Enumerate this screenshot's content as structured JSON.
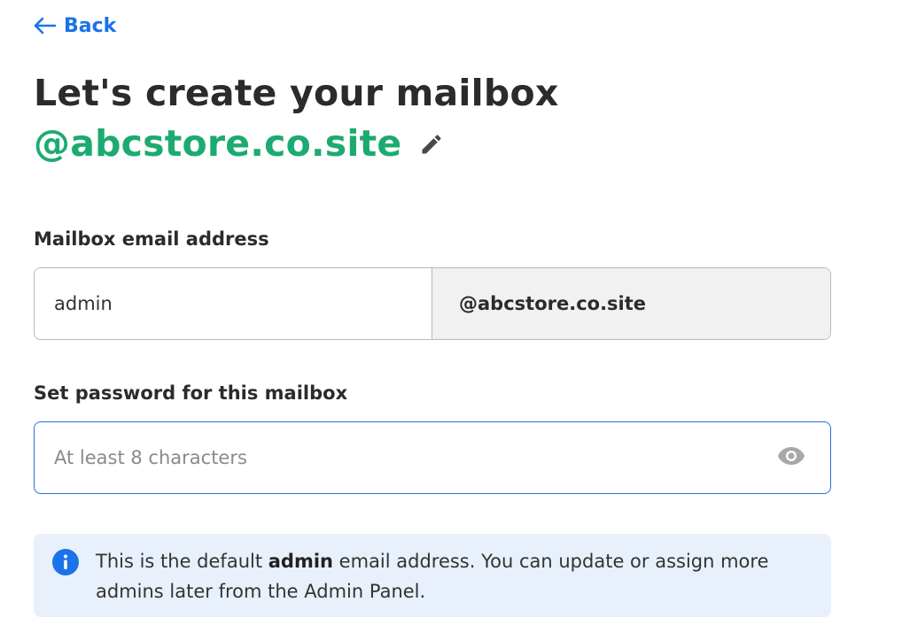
{
  "back": {
    "label": "Back"
  },
  "heading": {
    "title": "Let's create your mailbox",
    "domain": "@abcstore.co.site"
  },
  "email_field": {
    "label": "Mailbox email address",
    "value": "admin",
    "suffix": "@abcstore.co.site"
  },
  "password_field": {
    "label": "Set password for this mailbox",
    "placeholder": "At least 8 characters",
    "value": ""
  },
  "info": {
    "text_before": "This is the default ",
    "bold": "admin",
    "text_after": " email address. You can update or assign more admins later from the Admin Panel."
  },
  "icons": {
    "back": "arrow-left-icon",
    "edit": "pencil-icon",
    "visibility": "eye-icon",
    "info": "info-icon"
  },
  "colors": {
    "link": "#1a73e8",
    "domain": "#1cab6f",
    "focus_border": "#2a6fd6",
    "info_bg": "#e8f0fc",
    "suffix_bg": "#f1f1f1"
  }
}
